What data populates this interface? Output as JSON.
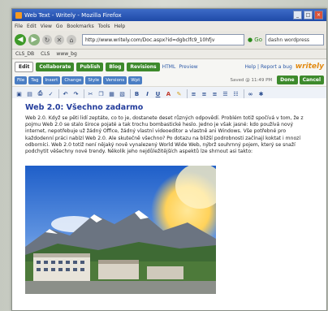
{
  "window": {
    "title": "Web Text - Writely - Mozilla Firefox",
    "controls": [
      "_",
      "□",
      "×"
    ]
  },
  "menu": [
    "File",
    "Edit",
    "View",
    "Go",
    "Bookmarks",
    "Tools",
    "Help"
  ],
  "nav": {
    "url": "http://www.writely.com/Doc.aspx?id=dgbclfc9_10hfjv",
    "go_label": "Go",
    "search_value": "dashn wordpress"
  },
  "bookmarks": [
    "CLS_DB",
    "CLS",
    "www_bg"
  ],
  "editor": {
    "tabs": [
      "Edit",
      "Collaborate",
      "Publish",
      "Blog",
      "Revisions",
      "HTML",
      "Preview"
    ],
    "help_links": "Help | Report a bug",
    "logo": "writely",
    "subtabs": [
      "File",
      "Tag",
      "Insert",
      "Change",
      "Style",
      "Versions",
      "Wpt"
    ],
    "saved_info": "Saved @ 11:49 PM",
    "done_label": "Done",
    "cancel_label": "Cancel"
  },
  "document": {
    "title": "Web 2.0: Všechno zadarmo",
    "paragraph": "Web 2.0. Když se pěti lidí zeptáte, co to je, dostanete deset různých odpovědí. Problém totiž spočívá v tom, že z pojmu Web 2.0 se stalo široce pojaté a tak trochu bombastické heslo. Jedno je však jasné: kdo používá nový internet, nepotřebuje už žádný Office, žádný vlastní videoeditor a vlastně ani Windows. Vše potřebné pro každodenní práci nabízí Web 2.0. Ale skutečně všechno? Po dotazu na bližší podrobnosti začínají koktat i mnozí odborníci. Web 2.0 totiž není nějaký nově vynalezený World Wide Web, nýbrž souhrnný pojem, který se snaží podchytit věšechny nové trendy. Několik jeho nejdůležitějších aspektů lze shrnout asi takto:"
  },
  "colors": {
    "title_blue": "#243d9c",
    "tab_green": "#3d8a2c",
    "subtab_blue": "#4a7ec4",
    "logo_orange": "#e28a12"
  }
}
